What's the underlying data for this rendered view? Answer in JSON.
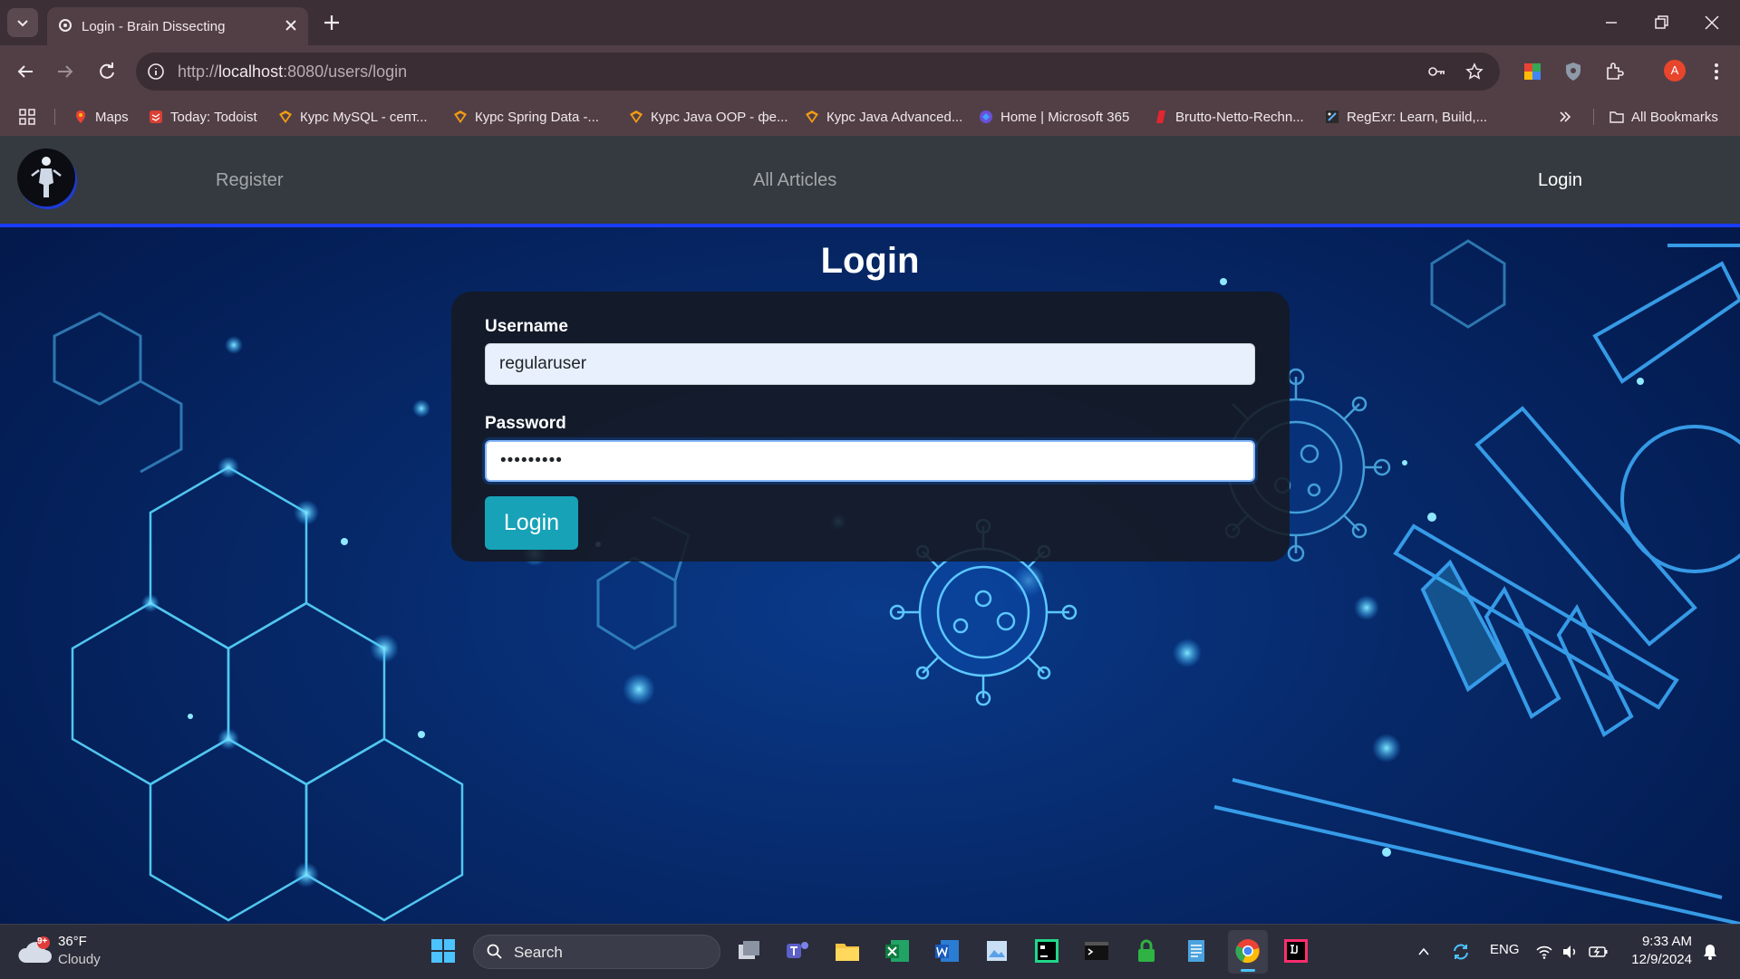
{
  "browser": {
    "tab_title": "Login - Brain Dissecting",
    "url_prefix": "http://",
    "url_host": "localhost",
    "url_rest": ":8080/users/login",
    "profile_initial": "A",
    "bookmarks": [
      {
        "label": "Maps",
        "icon": "maps-icon"
      },
      {
        "label": "Today: Todoist",
        "icon": "todoist-icon"
      },
      {
        "label": "Курс MySQL - септ...",
        "icon": "softuni-icon"
      },
      {
        "label": "Курс Spring Data -...",
        "icon": "softuni-icon"
      },
      {
        "label": "Курс Java OOP - фе...",
        "icon": "softuni-icon"
      },
      {
        "label": "Курс Java Advanced...",
        "icon": "softuni-icon"
      },
      {
        "label": "Home | Microsoft 365",
        "icon": "microsoft365-icon"
      },
      {
        "label": "Brutto-Netto-Rechn...",
        "icon": "calculator-icon"
      },
      {
        "label": "RegExr: Learn, Build,...",
        "icon": "regexr-icon"
      }
    ],
    "all_bookmarks_label": "All Bookmarks"
  },
  "site": {
    "nav": {
      "register": "Register",
      "all_articles": "All Articles",
      "login": "Login"
    },
    "page_title": "Login",
    "form": {
      "username_label": "Username",
      "username_value": "regularuser",
      "password_label": "Password",
      "password_value": "•••••••••",
      "submit_label": "Login"
    }
  },
  "taskbar": {
    "weather_badge": "9+",
    "weather_temp": "36°F",
    "weather_condition": "Cloudy",
    "search_label": "Search",
    "language": "ENG",
    "time": "9:33 AM",
    "date": "12/9/2024"
  },
  "colors": {
    "nav_bg": "#343a40",
    "nav_border": "#1a3cff",
    "button": "#17a2b8",
    "browser_frame": "#523f46"
  }
}
